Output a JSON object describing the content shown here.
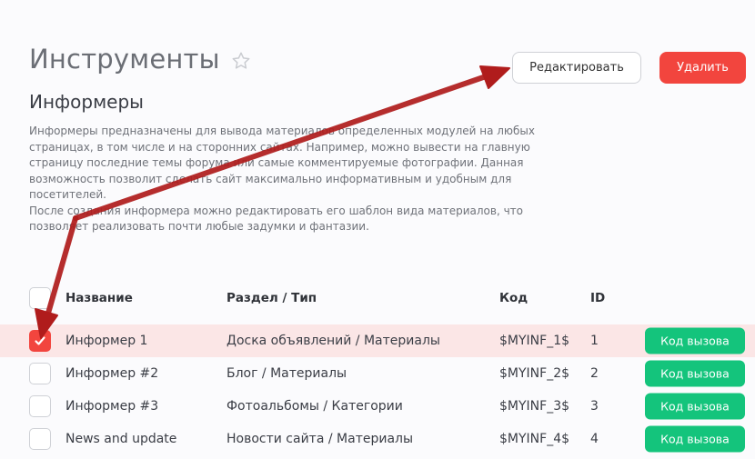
{
  "header": {
    "title": "Инструменты",
    "edit_label": "Редактировать",
    "delete_label": "Удалить"
  },
  "section": {
    "title": "Информеры",
    "description_1": "Информеры предназначены для вывода материалов определенных модулей на любых страницах, в том числе и на сторонних сайтах. Например, можно вывести на главную страницу последние темы форума или самые комментируемые фотографии. Данная возможность позволит сделать сайт максимально информативным и удобным для посетителей.",
    "description_2": "После создания информера можно редактировать его шаблон вида материалов, что позволяет реализовать почти любые задумки и фантазии."
  },
  "table": {
    "headers": {
      "name": "Название",
      "section": "Раздел / Тип",
      "code": "Код",
      "id": "ID"
    },
    "rows": [
      {
        "name": "Информер 1",
        "section": "Доска объявлений / Материалы",
        "code": "$MYINF_1$",
        "id": "1",
        "checked": true,
        "action": "Код вызова"
      },
      {
        "name": "Информер #2",
        "section": "Блог / Материалы",
        "code": "$MYINF_2$",
        "id": "2",
        "checked": false,
        "action": "Код вызова"
      },
      {
        "name": "Информер #3",
        "section": "Фотоальбомы / Категории",
        "code": "$MYINF_3$",
        "id": "3",
        "checked": false,
        "action": "Код вызова"
      },
      {
        "name": "News and update",
        "section": "Новости сайта / Материалы",
        "code": "$MYINF_4$",
        "id": "4",
        "checked": false,
        "action": "Код вызова"
      }
    ]
  },
  "colors": {
    "accent_red": "#f2453e",
    "call_green": "#14c47c",
    "selected_row": "#fbe6e6",
    "annotation_arrow": "#b01c1c"
  },
  "icons": [
    "star-icon",
    "checkmark-icon",
    "annotation-arrow"
  ]
}
